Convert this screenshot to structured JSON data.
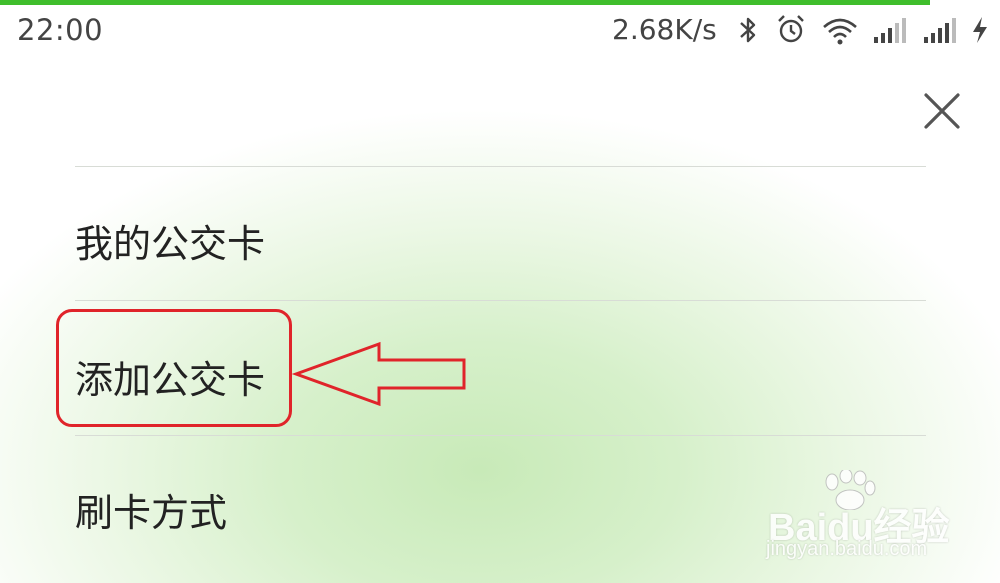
{
  "status_bar": {
    "time": "22:00",
    "network_speed": "2.68K/s",
    "icons": [
      "bluetooth-icon",
      "alarm-icon",
      "wifi-icon",
      "signal-icon",
      "signal-icon",
      "charging-icon"
    ]
  },
  "loading_progress": 0.93,
  "close_button": {
    "icon": "close-icon"
  },
  "menu": {
    "items": [
      {
        "label": "我的公交卡"
      },
      {
        "label": "添加公交卡",
        "highlighted": true
      },
      {
        "label": "刷卡方式"
      }
    ]
  },
  "annotation": {
    "color": "#e0242a",
    "arrow_points_to": "添加公交卡"
  },
  "watermark": {
    "brand": "Baidu经验",
    "url": "jingyan.baidu.com"
  },
  "colors": {
    "progress": "#3fbe2c",
    "text": "#222222",
    "annotation": "#e0242a"
  }
}
